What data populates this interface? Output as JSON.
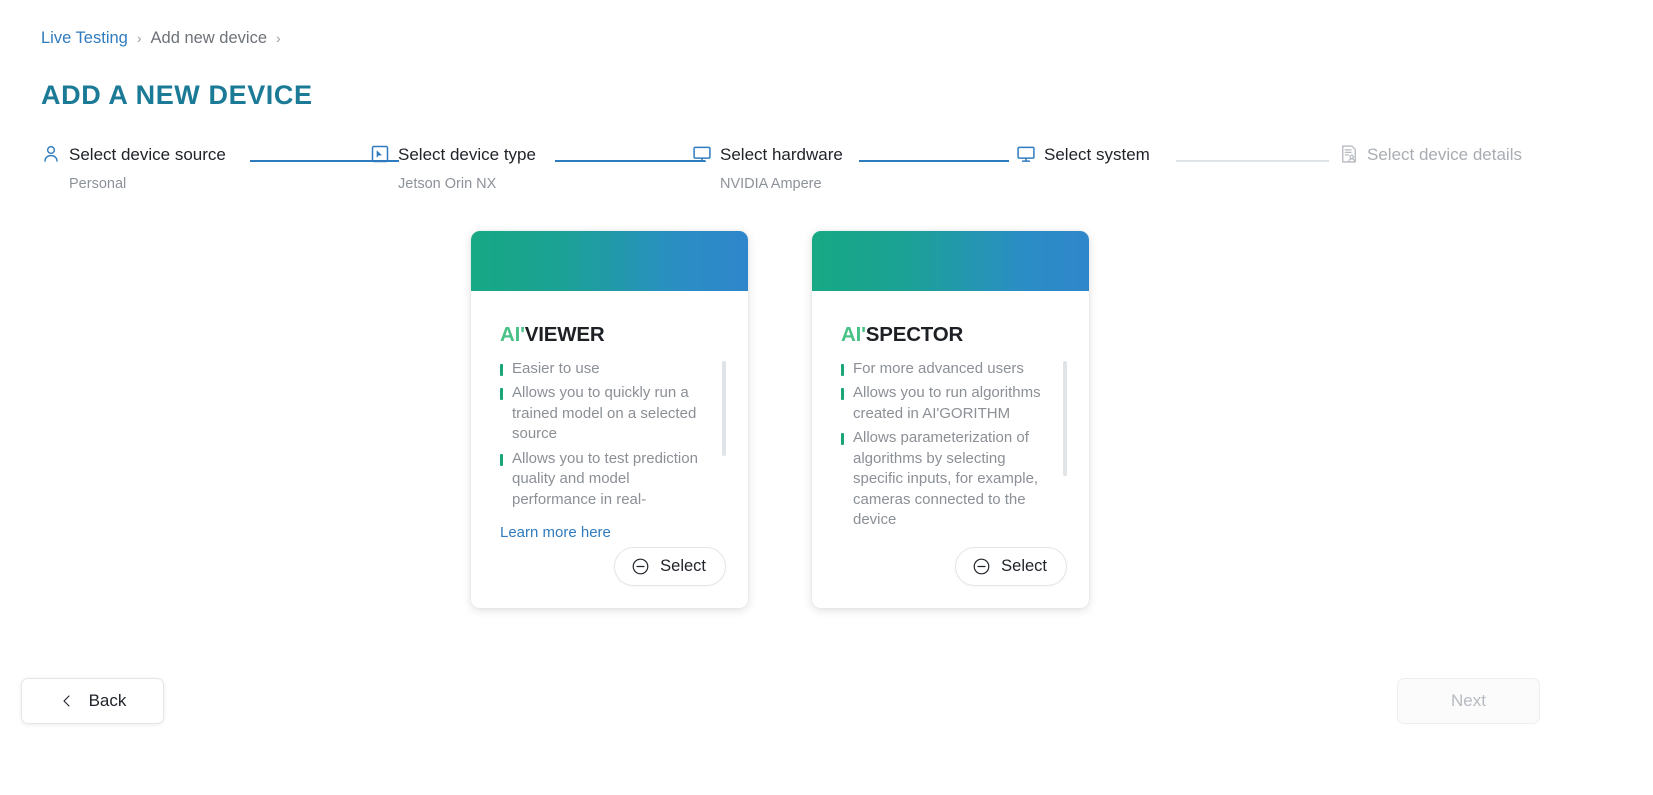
{
  "breadcrumb": {
    "items": [
      {
        "label": "Live Testing",
        "type": "link"
      },
      {
        "label": "Add new device",
        "type": "current"
      }
    ],
    "separator": "›"
  },
  "page_title": "ADD A NEW DEVICE",
  "colors": {
    "accent_title": "#1b7a96",
    "link": "#2f7bbf",
    "brand_green": "#49c287",
    "bullet_green": "#19a578",
    "banner_gradient_start": "#17a884",
    "banner_gradient_end": "#2f86cb",
    "muted_text": "#8b9096",
    "disabled_text": "#b6bbc1"
  },
  "stepper": {
    "steps": [
      {
        "label": "Select device source",
        "value": "Personal",
        "icon": "person-icon",
        "state": "complete"
      },
      {
        "label": "Select device type",
        "value": "Jetson Orin NX",
        "icon": "cursor-box-icon",
        "state": "complete"
      },
      {
        "label": "Select hardware",
        "value": "NVIDIA Ampere",
        "icon": "monitor-icon",
        "state": "complete"
      },
      {
        "label": "Select system",
        "value": "",
        "icon": "monitor-icon",
        "state": "active"
      },
      {
        "label": "Select device details",
        "value": "",
        "icon": "device-details-icon",
        "state": "inactive"
      }
    ]
  },
  "cards": [
    {
      "id": "aiviewer",
      "logo_prefix": "AI'",
      "logo_name": "VIEWER",
      "features": [
        "Easier to use",
        "Allows you to quickly run a trained model on a selected source",
        "Allows you to test prediction quality and model performance in real-"
      ],
      "learn_more": "Learn more here",
      "select_label": "Select",
      "select_icon": "circle-minus-icon"
    },
    {
      "id": "aispector",
      "logo_prefix": "AI'",
      "logo_name": "SPECTOR",
      "features": [
        "For more advanced users",
        "Allows you to run algorithms created in AI'GORITHM",
        "Allows parameterization of algorithms by selecting specific inputs, for example, cameras connected to the device"
      ],
      "learn_more": "",
      "select_label": "Select",
      "select_icon": "circle-minus-icon"
    }
  ],
  "footer": {
    "back_label": "Back",
    "back_icon": "chevron-left-icon",
    "next_label": "Next",
    "next_disabled": true
  }
}
